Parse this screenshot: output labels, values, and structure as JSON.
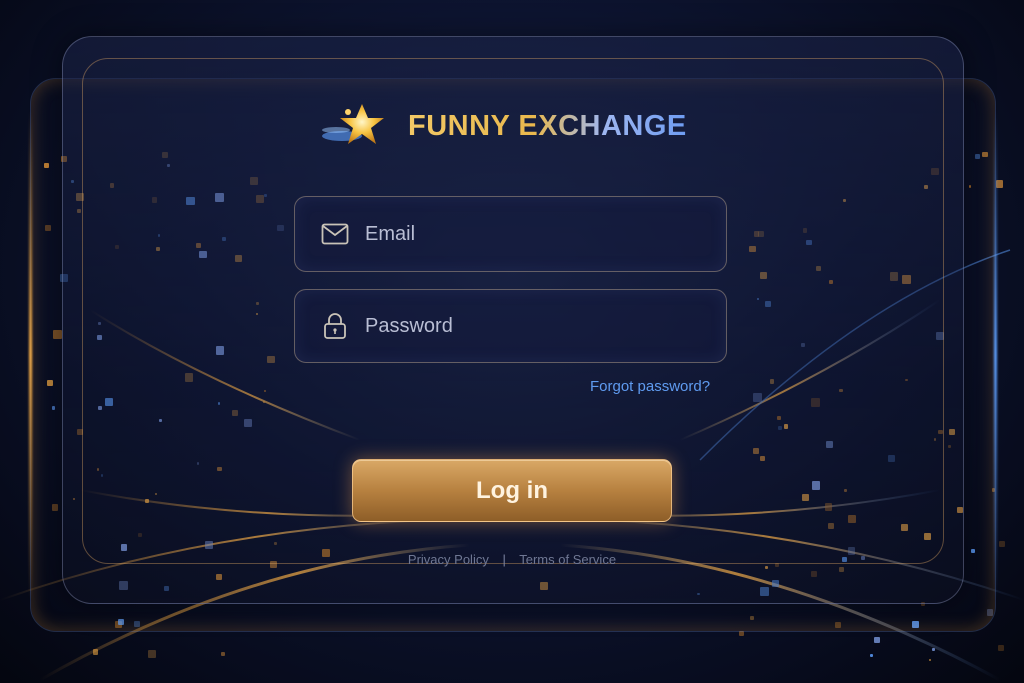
{
  "brand": {
    "name": "FUNNY EXCHANGE",
    "gold": "#f2c866",
    "blue": "#6e9cf2"
  },
  "form": {
    "email": {
      "placeholder": "Email",
      "value": "",
      "icon": "mail-icon"
    },
    "password": {
      "placeholder": "Password",
      "value": "",
      "icon": "lock-icon"
    },
    "forgot_label": "Forgot password?",
    "login_label": "Log in"
  },
  "footer": {
    "privacy_label": "Privacy Policy",
    "separator": "|",
    "terms_label": "Terms of Service"
  },
  "colors": {
    "background": "#0d1430",
    "accent": "#ffb347",
    "link": "#5f9bf0"
  }
}
